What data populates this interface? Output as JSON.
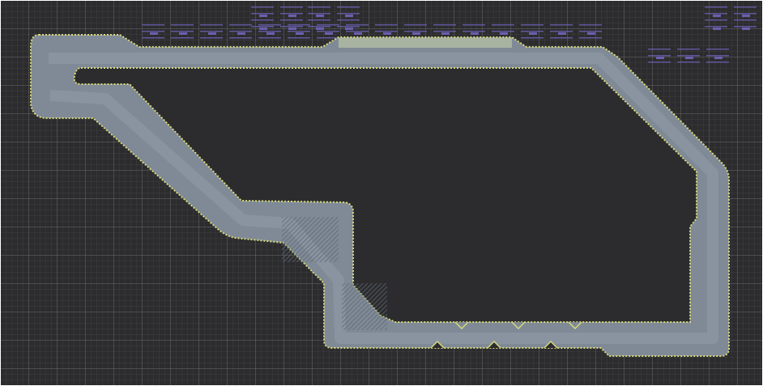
{
  "view": {
    "type": "top-down race track map",
    "grid": true,
    "colors": {
      "background": "#2c2c2e",
      "grid_major": "#6a6a6e",
      "grid_minor": "#3e3e42",
      "asphalt": "#7f8a96",
      "asphalt_inner": "#8d98a4",
      "asphalt_edge": "#6b7682",
      "kerb_line": "#d7d97a",
      "pit_strip": "#a8b3a2",
      "buildings": "#6a5fae",
      "frame": "#ffffff"
    }
  }
}
